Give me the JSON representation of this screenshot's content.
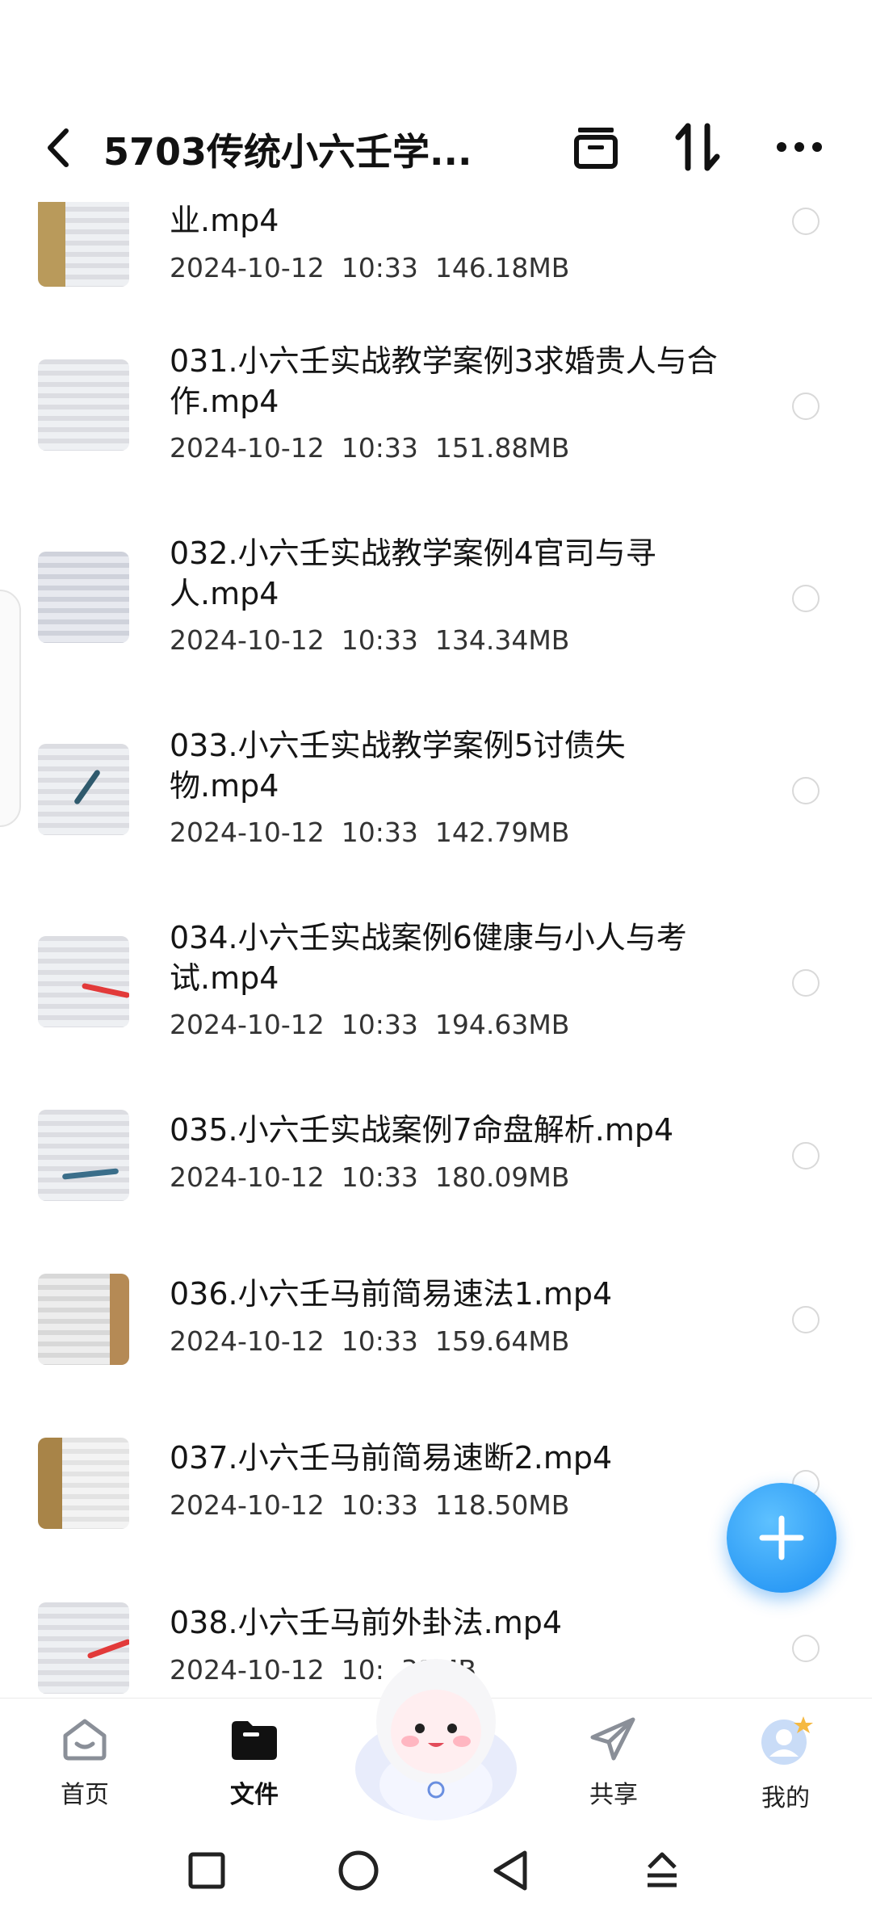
{
  "header": {
    "title": "5703传统小六壬学..."
  },
  "files": [
    {
      "name": "业.mp4",
      "date": "2024-10-12",
      "time": "10:33",
      "size": "146.18MB"
    },
    {
      "name": "031.小六壬实战教学案例3求婚贵人与合作.mp4",
      "date": "2024-10-12",
      "time": "10:33",
      "size": "151.88MB"
    },
    {
      "name": "032.小六壬实战教学案例4官司与寻人.mp4",
      "date": "2024-10-12",
      "time": "10:33",
      "size": "134.34MB"
    },
    {
      "name": "033.小六壬实战教学案例5讨债失物.mp4",
      "date": "2024-10-12",
      "time": "10:33",
      "size": "142.79MB"
    },
    {
      "name": "034.小六壬实战案例6健康与小人与考试.mp4",
      "date": "2024-10-12",
      "time": "10:33",
      "size": "194.63MB"
    },
    {
      "name": "035.小六壬实战案例7命盘解析.mp4",
      "date": "2024-10-12",
      "time": "10:33",
      "size": "180.09MB"
    },
    {
      "name": "036.小六壬马前简易速法1.mp4",
      "date": "2024-10-12",
      "time": "10:33",
      "size": "159.64MB"
    },
    {
      "name": "037.小六壬马前简易速断2.mp4",
      "date": "2024-10-12",
      "time": "10:33",
      "size": "118.50MB"
    },
    {
      "name": "038.小六壬马前外卦法.mp4",
      "date": "2024-10-12",
      "time": "10:",
      "size": "31MB"
    }
  ],
  "tabs": [
    {
      "label": "首页",
      "icon": "home-icon"
    },
    {
      "label": "文件",
      "icon": "folder-icon",
      "active": true
    },
    {
      "label": "共享",
      "icon": "share-icon"
    },
    {
      "label": "我的",
      "icon": "profile-icon"
    }
  ],
  "colors": {
    "accent": "#1a8df2",
    "text": "#151515",
    "meta": "#333333"
  }
}
